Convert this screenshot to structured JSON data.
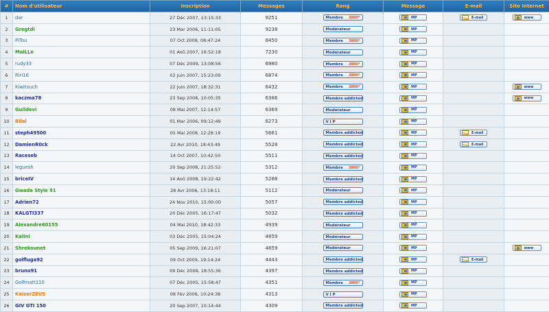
{
  "headers": {
    "num": "#",
    "username": "Nom d'utilisateur",
    "joined": "Inscription",
    "posts": "Messages",
    "rank": "Rang",
    "pm": "Message",
    "email": "E-mail",
    "website": "Site Internet"
  },
  "labels": {
    "pm": "MP",
    "email": "E-mail",
    "www": "www"
  },
  "rows": [
    {
      "num": "1",
      "name": "dar",
      "style": "plain",
      "joined": "27 Déc 2007, 13:15:33",
      "posts": "9251",
      "rank": "Membre",
      "star": "3000*",
      "email": true,
      "www": true
    },
    {
      "num": "2",
      "name": "Gregtdi",
      "style": "green",
      "joined": "23 Mar 2006, 11:11:05",
      "posts": "9238",
      "rank": "Modérateur",
      "star": "",
      "email": false,
      "www": false
    },
    {
      "num": "3",
      "name": "PiTou",
      "style": "plain",
      "joined": "07 Oct 2008, 08:47:24",
      "posts": "8450",
      "rank": "Membre",
      "star": "3000*",
      "email": false,
      "www": false
    },
    {
      "num": "4",
      "name": "MaiLLe",
      "style": "green",
      "joined": "01 Aoû 2007, 16:52:18",
      "posts": "7230",
      "rank": "Modérateur",
      "star": "",
      "email": false,
      "www": false
    },
    {
      "num": "5",
      "name": "rudy33",
      "style": "plain",
      "joined": "07 Déc 2009, 13:08:56",
      "posts": "6980",
      "rank": "Membre",
      "star": "3000*",
      "email": false,
      "www": false
    },
    {
      "num": "6",
      "name": "Riri16",
      "style": "plain",
      "joined": "02 Juin 2007, 15:23:09",
      "posts": "6874",
      "rank": "Membre",
      "star": "3000*",
      "email": false,
      "www": false
    },
    {
      "num": "7",
      "name": "Kiwitouch",
      "style": "plain",
      "joined": "22 Juin 2007, 18:32:31",
      "posts": "6432",
      "rank": "Membre",
      "star": "3000*",
      "email": false,
      "www": true
    },
    {
      "num": "8",
      "name": "kaczma78",
      "style": "navy",
      "joined": "23 Sep 2008, 10:05:35",
      "posts": "6386",
      "rank": "Membre addicted",
      "star": "",
      "email": false,
      "www": true
    },
    {
      "num": "9",
      "name": "Guildevi",
      "style": "green",
      "joined": "08 Mai 2007, 12:14:57",
      "posts": "6369",
      "rank": "Modérateur",
      "star": "",
      "email": false,
      "www": false
    },
    {
      "num": "10",
      "name": "Bilal",
      "style": "orange",
      "joined": "01 Mar 2006, 09:12:49",
      "posts": "6273",
      "rank": "V I P",
      "star": "",
      "email": false,
      "www": false
    },
    {
      "num": "11",
      "name": "steph49500",
      "style": "navy",
      "joined": "05 Mai 2008, 12:28:19",
      "posts": "5661",
      "rank": "Membre addicted",
      "star": "",
      "email": true,
      "www": false
    },
    {
      "num": "12",
      "name": "DamienR0ck",
      "style": "navy",
      "joined": "22 Avr 2010, 18:43:49",
      "posts": "5528",
      "rank": "Membre addicted",
      "star": "",
      "email": true,
      "www": false
    },
    {
      "num": "13",
      "name": "Raceseb",
      "style": "navy",
      "joined": "14 Oct 2007, 10:42:50",
      "posts": "5511",
      "rank": "Membre addicted",
      "star": "",
      "email": false,
      "www": false
    },
    {
      "num": "14",
      "name": "leguesh",
      "style": "plain",
      "joined": "20 Sep 2008, 21:25:52",
      "posts": "5312",
      "rank": "Membre",
      "star": "3000*",
      "email": false,
      "www": false
    },
    {
      "num": "15",
      "name": "briceIV",
      "style": "navy",
      "joined": "14 Aoû 2008, 19:22:42",
      "posts": "5288",
      "rank": "Membre addicted",
      "star": "",
      "email": false,
      "www": false
    },
    {
      "num": "16",
      "name": "Gwada Style 91",
      "style": "green",
      "joined": "28 Avr 2006, 13:18:11",
      "posts": "5112",
      "rank": "Modérateur",
      "star": "",
      "email": false,
      "www": false
    },
    {
      "num": "17",
      "name": "Adrien72",
      "style": "navy",
      "joined": "24 Nov 2010, 15:00:00",
      "posts": "5057",
      "rank": "Membre addicted",
      "star": "",
      "email": false,
      "www": false
    },
    {
      "num": "18",
      "name": "KALGTI337",
      "style": "navy",
      "joined": "20 Déc 2005, 16:17:47",
      "posts": "5032",
      "rank": "Membre addicted",
      "star": "",
      "email": false,
      "www": false
    },
    {
      "num": "19",
      "name": "Alexandre60155",
      "style": "green",
      "joined": "04 Mai 2010, 18:42:33",
      "posts": "4939",
      "rank": "Modérateur",
      "star": "",
      "email": false,
      "www": false
    },
    {
      "num": "20",
      "name": "Kalini",
      "style": "green",
      "joined": "03 Déc 2005, 15:04:24",
      "posts": "4859",
      "rank": "Modérateur",
      "star": "",
      "email": false,
      "www": false
    },
    {
      "num": "21",
      "name": "Shrekounet",
      "style": "green",
      "joined": "05 Sep 2009, 16:21:07",
      "posts": "4659",
      "rank": "Modérateur",
      "star": "",
      "email": false,
      "www": true
    },
    {
      "num": "22",
      "name": "golfluga92",
      "style": "navy",
      "joined": "09 Oct 2009, 19:14:24",
      "posts": "4443",
      "rank": "Membre addicted",
      "star": "",
      "email": true,
      "www": false
    },
    {
      "num": "23",
      "name": "bruno91",
      "style": "navy",
      "joined": "09 Déc 2008, 18:55:36",
      "posts": "4397",
      "rank": "Membre addicted",
      "star": "",
      "email": false,
      "www": false
    },
    {
      "num": "24",
      "name": "Golfmatt110",
      "style": "plain",
      "joined": "07 Déc 2005, 15:58:47",
      "posts": "4351",
      "rank": "Membre",
      "star": "3000*",
      "email": false,
      "www": false
    },
    {
      "num": "25",
      "name": "KaiserZEUS",
      "style": "orange",
      "joined": "08 Fév 2006, 10:24:38",
      "posts": "4313",
      "rank": "V I P",
      "star": "",
      "email": false,
      "www": false
    },
    {
      "num": "26",
      "name": "GIV GTI 150",
      "style": "navy",
      "joined": "20 Sep 2007, 10:14:44",
      "posts": "4309",
      "rank": "Membre addicted",
      "star": "",
      "email": false,
      "www": false
    }
  ]
}
